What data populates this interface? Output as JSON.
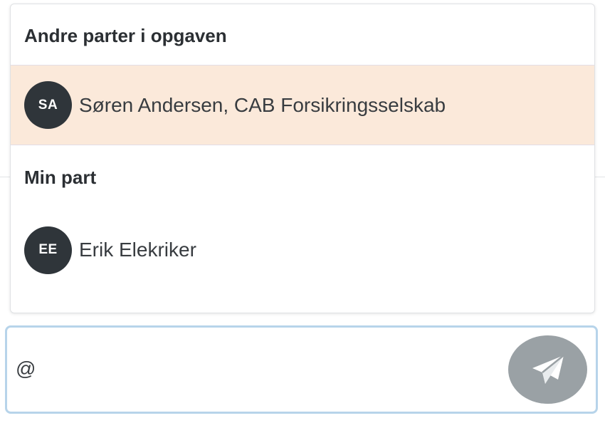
{
  "mention_popup": {
    "other_parties": {
      "title": "Andre parter i opgaven",
      "items": [
        {
          "initials": "SA",
          "label": "Søren Andersen, CAB Forsikringsselskab"
        }
      ]
    },
    "my_party": {
      "title": "Min part",
      "items": [
        {
          "initials": "EE",
          "label": "Erik Elekriker"
        }
      ]
    }
  },
  "composer": {
    "value": "@",
    "send_icon": "paper-plane-icon"
  },
  "colors": {
    "highlight": "#fbe9da",
    "avatar_bg": "#2f353a",
    "composer_border": "#b7d4ea",
    "send_button_bg": "#9aa1a5"
  }
}
